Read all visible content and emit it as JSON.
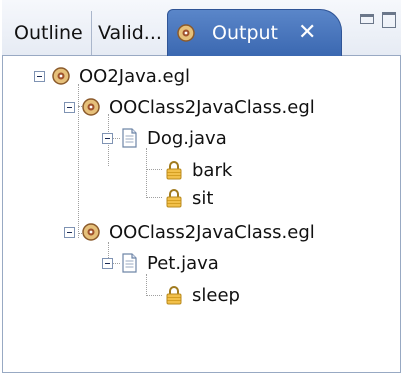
{
  "tabs": [
    {
      "label": "Outline"
    },
    {
      "label": "Valid..."
    },
    {
      "label": "Output",
      "active": true
    }
  ],
  "tree": {
    "root": {
      "label": "OO2Java.egl"
    },
    "class1": {
      "label": "OOClass2JavaClass.egl"
    },
    "dog": {
      "label": "Dog.java"
    },
    "bark": {
      "label": "bark"
    },
    "sit": {
      "label": "sit"
    },
    "class2": {
      "label": "OOClass2JavaClass.egl"
    },
    "pet": {
      "label": "Pet.java"
    },
    "sleep": {
      "label": "sleep"
    }
  },
  "colors": {
    "active_tab": "#3b68b1",
    "tab_bar": "#e6ebf4",
    "border": "#98a9c3"
  }
}
